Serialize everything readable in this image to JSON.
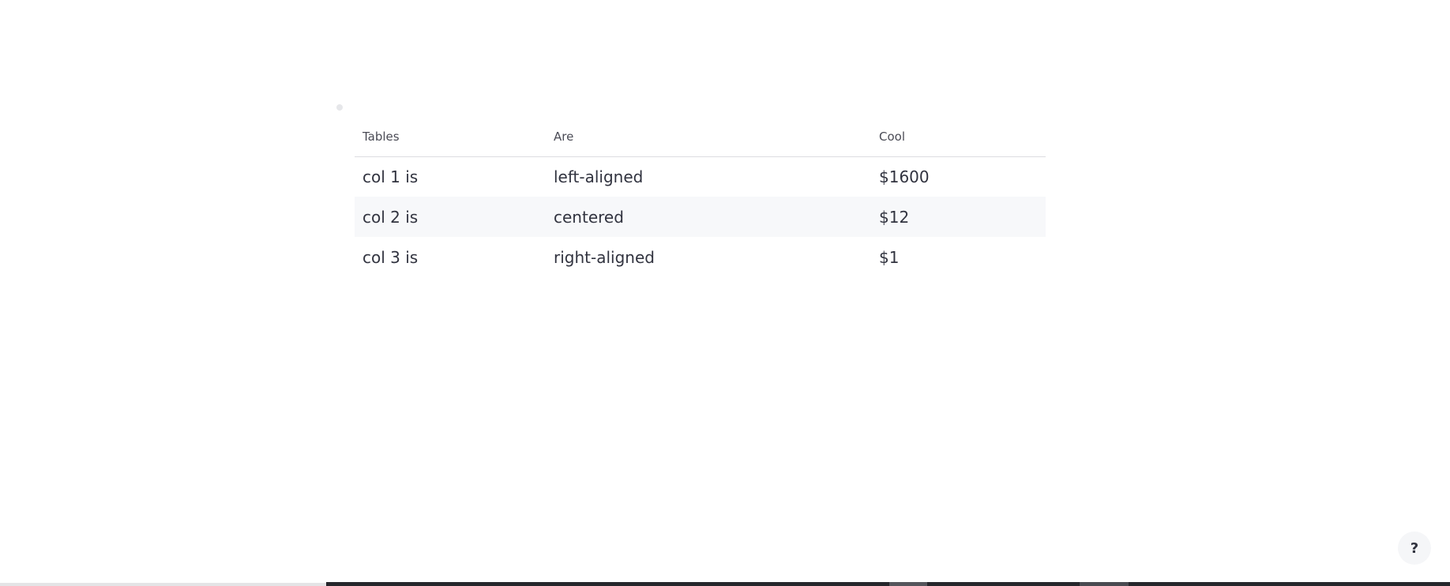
{
  "table": {
    "headers": [
      "Tables",
      "Are",
      "Cool"
    ],
    "rows": [
      [
        "col 1 is",
        "left-aligned",
        "$1600"
      ],
      [
        "col 2 is",
        "centered",
        "$12"
      ],
      [
        "col 3 is",
        "right-aligned",
        "$1"
      ]
    ]
  },
  "help": {
    "label": "?"
  }
}
